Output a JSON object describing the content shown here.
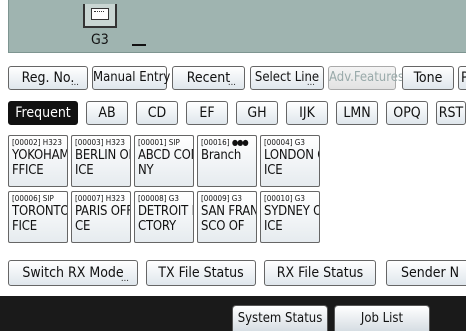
{
  "display": {
    "line": "G3"
  },
  "tabs": {
    "reg_no": "Reg. No.",
    "manual_entry": "Manual Entry",
    "recent": "Recent",
    "select_line": "Select Line",
    "adv_features": "Adv.Features",
    "tone": "Tone",
    "more": "P"
  },
  "index": [
    "Frequent",
    "AB",
    "CD",
    "EF",
    "GH",
    "IJK",
    "LMN",
    "OPQ",
    "RST"
  ],
  "destinations": [
    {
      "code": "[00002] H323",
      "name1": "YOKOHAMA O",
      "name2": "FFICE"
    },
    {
      "code": "[00003] H323",
      "name1": "BERLIN OFF",
      "name2": "ICE"
    },
    {
      "code": "[00001] SIP",
      "name1": "ABCD COMPA",
      "name2": "NY"
    },
    {
      "code": "[00016]",
      "name1": "Branch",
      "name2": ""
    },
    {
      "code": "[00004] G3",
      "name1": "LONDON OFF",
      "name2": "ICE"
    },
    {
      "code": "[00006] SIP",
      "name1": "TORONTO OF",
      "name2": "FICE"
    },
    {
      "code": "[00007] H323",
      "name1": "PARIS OFFI",
      "name2": "CE"
    },
    {
      "code": "[00008] G3",
      "name1": "DETROIT FA",
      "name2": "CTORY"
    },
    {
      "code": "[00009] G3",
      "name1": "SAN FRANCI",
      "name2": "SCO OF"
    },
    {
      "code": "[00010] G3",
      "name1": "SYDNEY OFF",
      "name2": "ICE"
    }
  ],
  "functions": {
    "switch_rx_mode": "Switch RX Mode",
    "tx_file_status": "TX File Status",
    "rx_file_status": "RX File Status",
    "sender": "Sender N"
  },
  "status_bar": {
    "system_status": "System Status",
    "job_list": "Job List"
  }
}
